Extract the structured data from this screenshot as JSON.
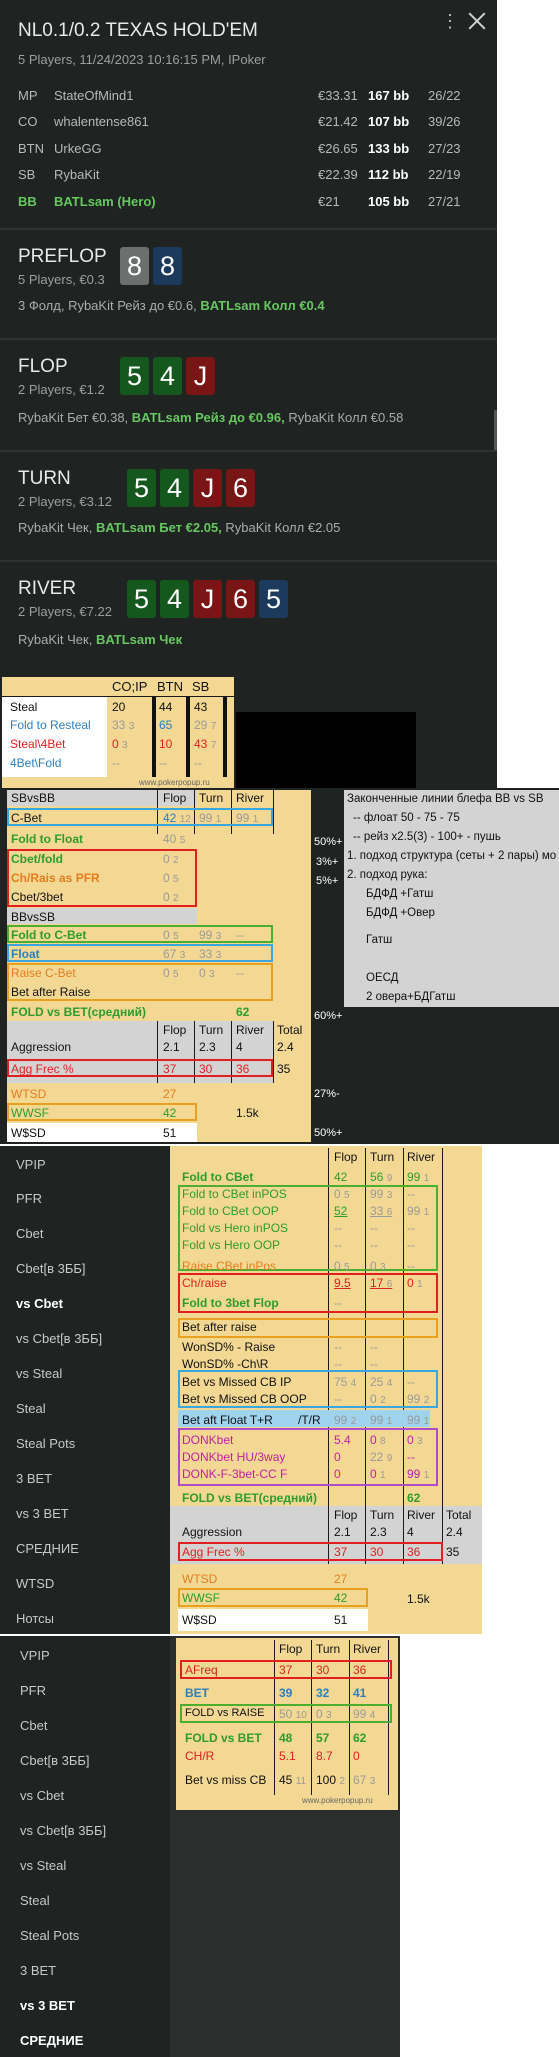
{
  "header": {
    "title": "NL0.1/0.2 TEXAS HOLD'EM",
    "subtitle": "5 Players, 11/24/2023 10:16:15 PM, IPoker"
  },
  "players": [
    {
      "pos": "MP",
      "name": "StateOfMind1",
      "money": "€33.31",
      "bb": "167 bb",
      "stat": "26/22"
    },
    {
      "pos": "CO",
      "name": "whalentense861",
      "money": "€21.42",
      "bb": "107 bb",
      "stat": "39/26"
    },
    {
      "pos": "BTN",
      "name": "UrkeGG",
      "money": "€26.65",
      "bb": "133 bb",
      "stat": "27/23"
    },
    {
      "pos": "SB",
      "name": "RybaKit",
      "money": "€22.39",
      "bb": "112 bb",
      "stat": "22/19"
    },
    {
      "pos": "BB",
      "name": "BATLsam (Hero)",
      "money": "€21",
      "bb": "105 bb",
      "stat": "27/21"
    }
  ],
  "streets": {
    "preflop": {
      "name": "PREFLOP",
      "sub": "5 Players, €0.3",
      "act1": "3 Фолд, RybaKit Рейз до €0.6, ",
      "hero": "BATLsam Колл €0.4",
      "act2": "",
      "cards": [
        "8",
        "8"
      ]
    },
    "flop": {
      "name": "FLOP",
      "sub": "2 Players, €1.2",
      "act1": "RybaKit Бет €0.38, ",
      "hero": "BATLsam Рейз до €0.96,",
      "act2": " RybaKit Колл €0.58",
      "cards": [
        "5",
        "4",
        "J"
      ]
    },
    "turn": {
      "name": "TURN",
      "sub": "2 Players, €3.12",
      "act1": "RybaKit Чек, ",
      "hero": "BATLsam Бет €2.05,",
      "act2": " RybaKit Колл €2.05",
      "cards": [
        "5",
        "4",
        "J",
        "6"
      ]
    },
    "river": {
      "name": "RIVER",
      "sub": "2 Players, €7.22",
      "act1": "RybaKit Чек, ",
      "hero": "BATLsam Чек",
      "act2": "",
      "cards": [
        "5",
        "4",
        "J",
        "6",
        "5"
      ]
    }
  },
  "steal_table": {
    "cols": [
      "CO;IP",
      "BTN",
      "SB"
    ],
    "rows": [
      {
        "label": "Steal",
        "vals": [
          [
            "20",
            ""
          ],
          [
            "44",
            ""
          ],
          [
            "43",
            ""
          ]
        ]
      },
      {
        "label": "Fold to Resteal",
        "vals": [
          [
            "33",
            "3"
          ],
          [
            "65",
            ""
          ],
          [
            "29",
            "7"
          ]
        ]
      },
      {
        "label": "Steal\\4Bet",
        "vals": [
          [
            "0",
            "3"
          ],
          [
            "10",
            ""
          ],
          [
            "43",
            "7"
          ]
        ]
      },
      {
        "label": "4Bet\\Fold",
        "vals": [
          [
            "--",
            ""
          ],
          [
            "--",
            ""
          ],
          [
            "--",
            ""
          ]
        ]
      }
    ],
    "watermark": "www.pokerpopup.ru"
  },
  "sbvsbb": {
    "title": "SBvsBB",
    "cols": [
      "Flop",
      "Turn",
      "River"
    ],
    "cbet": {
      "label": "C-Bet",
      "vals": [
        "42",
        "99",
        "99"
      ],
      "subs": [
        "12",
        "1",
        "1"
      ]
    },
    "fold_float": {
      "label": "Fold to Float",
      "val": "40",
      "sub": "5"
    },
    "cbet_fold": {
      "label": "Cbet/fold",
      "val": "0",
      "sub": "2"
    },
    "ch_rais": {
      "label": "Ch/Rais as PFR",
      "val": "0",
      "sub": "5"
    },
    "cbet3": {
      "label": "Cbet/3bet",
      "val": "0",
      "sub": "2"
    },
    "pct": [
      "50%+",
      "3%+",
      "5%+"
    ],
    "bbvssb": "BBvsSB",
    "fold_cbet": {
      "label": "Fold to C-Bet",
      "vals": [
        "0",
        "99",
        "--"
      ],
      "subs": [
        "5",
        "3",
        ""
      ]
    },
    "float": {
      "label": "Float",
      "vals": [
        "67",
        "33"
      ],
      "subs": [
        "3",
        "3"
      ]
    },
    "raise_cbet": {
      "label": "Raise C-Bet",
      "vals": [
        "0",
        "0",
        "--"
      ],
      "subs": [
        "5",
        "3",
        ""
      ]
    },
    "bet_after_raise": {
      "label": "Bet after Raise",
      "vals": [
        "",
        "",
        ""
      ]
    },
    "fold_vs_bet": {
      "label": "FOLD vs BET(средний)",
      "val": "62",
      "pct": "60%+"
    },
    "agg_head": [
      "Flop",
      "Turn",
      "River",
      "Total"
    ],
    "aggression": {
      "label": "Aggression",
      "vals": [
        "2.1",
        "2.3",
        "4",
        "2.4"
      ]
    },
    "agg_frec": {
      "label": "Agg Frec %",
      "vals": [
        "37",
        "30",
        "36",
        "35"
      ]
    },
    "wtsd": {
      "label": "WTSD",
      "val": "27",
      "pct": "27%-"
    },
    "wwsf": {
      "label": "WWSF",
      "val": "42",
      "extra": "1.5k"
    },
    "wsd": {
      "label": "W$SD",
      "val": "51",
      "pct": "50%+"
    }
  },
  "notes": {
    "title": "Законченные линии блефа BB vs SB",
    "l1": "--  флоат 50 - 75 - 75",
    "l2": "--  рейз x2.5(3)  - 100+ - пушь",
    "l3": "1. подход структура (сеты + 2 пары) мо",
    "l4": "2. подход рука:",
    "l5": "БДФД +Гатш",
    "l6": "БДФД +Овер",
    "l7": "Гатш",
    "l8": "ОЕСД",
    "l9": "2 овера+БДГатш"
  },
  "nav1": [
    "VPIP",
    "PFR",
    "Cbet",
    "Cbet[в 3ББ]",
    "vs Cbet",
    "vs Cbet[в 3ББ]",
    "vs Steal",
    "Steal",
    "Steal Pots",
    "3 BET",
    "vs 3 BET",
    "СРЕДНИЕ",
    "WTSD",
    "Нотсы"
  ],
  "vscbet": {
    "cols": [
      "Flop",
      "Turn",
      "River"
    ],
    "rows": [
      {
        "label": "Fold to CBet",
        "vals": [
          "42",
          "56",
          "99"
        ],
        "subs": [
          "",
          "9",
          "1"
        ]
      },
      {
        "label": "Fold to CBet inPOS",
        "vals": [
          "0",
          "99",
          "--"
        ],
        "subs": [
          "5",
          "3",
          ""
        ]
      },
      {
        "label": "Fold to CBet OOP",
        "vals": [
          "52",
          "33",
          "99"
        ],
        "subs": [
          "",
          "6",
          "1"
        ]
      },
      {
        "label": "Fold vs Hero inPOS",
        "vals": [
          "--",
          "--",
          "--"
        ],
        "subs": [
          "",
          "",
          ""
        ]
      },
      {
        "label": "Fold vs Hero OOP",
        "vals": [
          "--",
          "--",
          "--"
        ],
        "subs": [
          "",
          "",
          ""
        ]
      },
      {
        "label": "Raise CBet inPos",
        "vals": [
          "0",
          "0",
          "--"
        ],
        "subs": [
          "5",
          "3",
          ""
        ]
      },
      {
        "label": "Ch/raise",
        "vals": [
          "9.5",
          "17",
          "0"
        ],
        "subs": [
          "",
          "6",
          "1"
        ]
      },
      {
        "label": "Fold to 3bet Flop",
        "vals": [
          "--",
          "",
          ""
        ],
        "subs": [
          "",
          "",
          ""
        ]
      },
      {
        "label": "Bet after raise",
        "vals": [
          "",
          "",
          ""
        ],
        "subs": [
          "",
          "",
          ""
        ]
      },
      {
        "label": "WonSD% - Raise",
        "vals": [
          "--",
          "--",
          ""
        ],
        "subs": [
          "",
          "",
          ""
        ]
      },
      {
        "label": "WonSD% -Ch\\R",
        "vals": [
          "--",
          "--",
          ""
        ],
        "subs": [
          "",
          "",
          ""
        ]
      },
      {
        "label": "Bet vs Missed CB IP",
        "vals": [
          "75",
          "25",
          "--"
        ],
        "subs": [
          "4",
          "4",
          ""
        ]
      },
      {
        "label": "Bet vs Missed CB OOP",
        "vals": [
          "--",
          "0",
          "99"
        ],
        "subs": [
          "",
          "2",
          "2"
        ]
      },
      {
        "label": "Bet aft Float T+R",
        "vals": [
          "99",
          "99",
          "99"
        ],
        "subs": [
          "2",
          "1",
          "1"
        ]
      },
      {
        "label": "DONKbet",
        "vals": [
          "5.4",
          "0",
          "0"
        ],
        "subs": [
          "",
          "8",
          "3"
        ]
      },
      {
        "label": "DONKbet HU/3way",
        "vals": [
          "0",
          "22",
          "--"
        ],
        "subs": [
          "",
          "9",
          ""
        ]
      },
      {
        "label": "DONK-F-3bet-CC F",
        "vals": [
          "0",
          "0",
          "99"
        ],
        "subs": [
          "",
          "1",
          "1"
        ]
      }
    ],
    "tr_label": "/T/R",
    "fold_vs_bet": {
      "label": "FOLD vs BET(средний)",
      "val": "62"
    },
    "agg_head": [
      "Flop",
      "Turn",
      "River",
      "Total"
    ],
    "aggression": {
      "label": "Aggression",
      "vals": [
        "2.1",
        "2.3",
        "4",
        "2.4"
      ]
    },
    "agg_frec": {
      "label": "Agg Frec %",
      "vals": [
        "37",
        "30",
        "36",
        "35"
      ]
    },
    "wtsd": {
      "label": "WTSD",
      "val": "27"
    },
    "wwsf": {
      "label": "WWSF",
      "val": "42",
      "extra": "1.5k"
    },
    "wsd": {
      "label": "W$SD",
      "val": "51"
    }
  },
  "nav2": [
    "VPIP",
    "PFR",
    "Cbet",
    "Cbet[в 3ББ]",
    "vs Cbet",
    "vs Cbet[в 3ББ]",
    "vs Steal",
    "Steal",
    "Steal Pots",
    "3 BET",
    "vs 3 BET",
    "СРЕДНИЕ"
  ],
  "vs3bet": {
    "cols": [
      "Flop",
      "Turn",
      "River"
    ],
    "afreq": {
      "label": "AFreq",
      "vals": [
        "37",
        "30",
        "36"
      ]
    },
    "bet": {
      "label": "BET",
      "vals": [
        "39",
        "32",
        "41"
      ]
    },
    "fold_raise": {
      "label": "FOLD vs RAISE",
      "vals": [
        "50",
        "0",
        "99"
      ],
      "subs": [
        "10",
        "3",
        "4"
      ]
    },
    "fold_bet": {
      "label": "FOLD vs BET",
      "vals": [
        "48",
        "57",
        "62"
      ]
    },
    "chr": {
      "label": "CH/R",
      "vals": [
        "5.1",
        "8.7",
        "0"
      ]
    },
    "bvmcb": {
      "label": "Bet vs miss CB",
      "vals": [
        "45",
        "100",
        "67"
      ],
      "subs": [
        "11",
        "2",
        "3"
      ]
    },
    "watermark": "www.pokerpopup.ru"
  }
}
